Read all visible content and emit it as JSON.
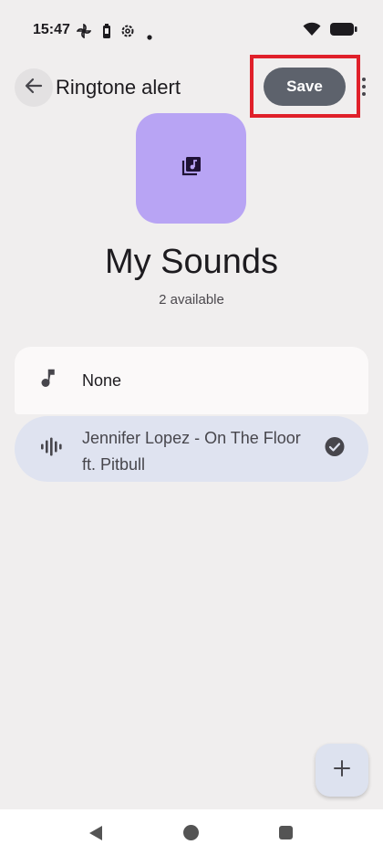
{
  "status_bar": {
    "time": "15:47",
    "icons": [
      "pinwheel-icon",
      "battery-saver-icon",
      "settings-icon",
      "dot-icon",
      "wifi-icon",
      "battery-icon"
    ]
  },
  "header": {
    "title": "Ringtone alert",
    "save_label": "Save",
    "back_icon": "arrow-back-icon",
    "more_icon": "more-vert-icon"
  },
  "main": {
    "art_icon": "music-library-icon",
    "title": "My Sounds",
    "subtitle": "2 available"
  },
  "sounds": [
    {
      "label": "None",
      "icon": "music-note-icon",
      "selected": false
    },
    {
      "label": "Jennifer Lopez - On The Floor ft. Pitbull",
      "icon": "sound-wave-icon",
      "selected": true
    }
  ],
  "fab": {
    "icon": "add-icon"
  },
  "colors": {
    "background": "#f0eeee",
    "save_button": "#5d626c",
    "album_art": "#b8a4f4",
    "selected_row": "#dfe3f0",
    "highlight_box": "#e0202a"
  },
  "nav": {
    "back_icon": "nav-back-icon",
    "home_icon": "nav-home-icon",
    "recents_icon": "nav-recents-icon"
  }
}
